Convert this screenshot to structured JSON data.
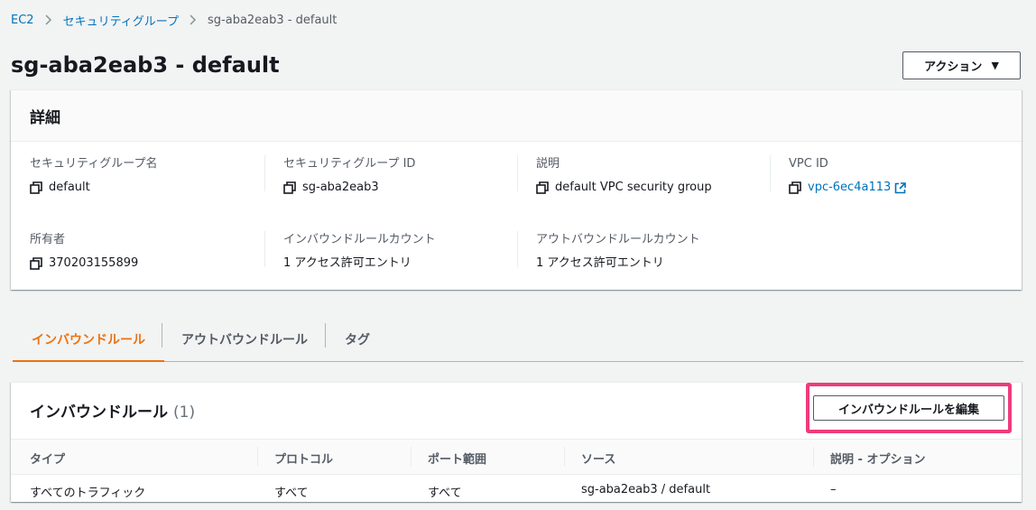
{
  "breadcrumb": {
    "items": [
      "EC2",
      "セキュリティグループ"
    ],
    "current": "sg-aba2eab3 - default"
  },
  "page_title": "sg-aba2eab3 - default",
  "actions_label": "アクション",
  "details": {
    "header": "詳細",
    "fields": {
      "sg_name": {
        "label": "セキュリティグループ名",
        "value": "default"
      },
      "sg_id": {
        "label": "セキュリティグループ ID",
        "value": "sg-aba2eab3"
      },
      "description": {
        "label": "説明",
        "value": "default VPC security group"
      },
      "vpc_id": {
        "label": "VPC ID",
        "value": "vpc-6ec4a113"
      },
      "owner": {
        "label": "所有者",
        "value": "370203155899"
      },
      "inbound_count": {
        "label": "インバウンドルールカウント",
        "value": "1 アクセス許可エントリ"
      },
      "outbound_count": {
        "label": "アウトバウンドルールカウント",
        "value": "1 アクセス許可エントリ"
      }
    }
  },
  "tabs": [
    {
      "label": "インバウンドルール",
      "active": true
    },
    {
      "label": "アウトバウンドルール",
      "active": false
    },
    {
      "label": "タグ",
      "active": false
    }
  ],
  "rules": {
    "title": "インバウンドルール",
    "count": "(1)",
    "edit_button": "インバウンドルールを編集",
    "columns": [
      "タイプ",
      "プロトコル",
      "ポート範囲",
      "ソース",
      "説明 - オプション"
    ],
    "rows": [
      [
        "すべてのトラフィック",
        "すべて",
        "すべて",
        "sg-aba2eab3 / default",
        "–"
      ]
    ]
  },
  "colors": {
    "accent": "#ec7211",
    "link": "#0073bb",
    "highlight": "#ef3b7b"
  }
}
